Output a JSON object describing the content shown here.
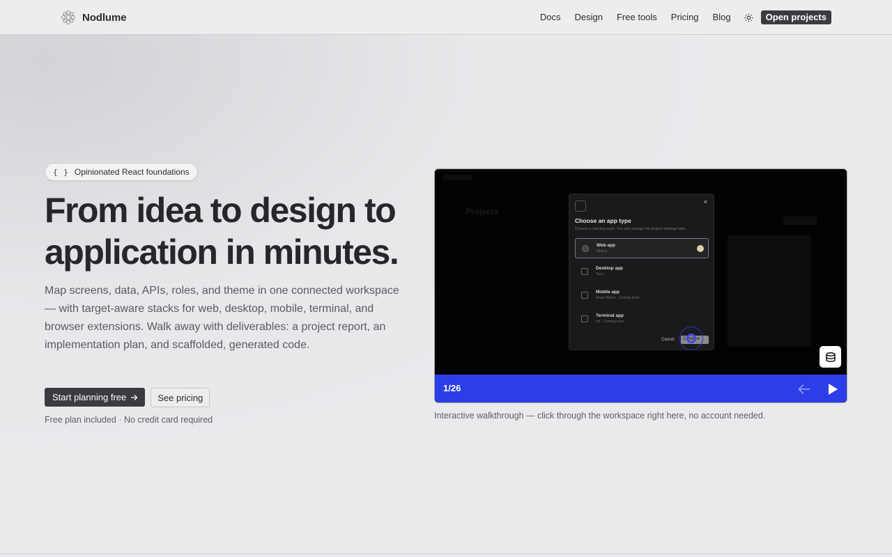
{
  "brand": {
    "name": "Nodlume"
  },
  "nav": {
    "items": [
      "Docs",
      "Design",
      "Free tools",
      "Pricing",
      "Blog"
    ],
    "cta": "Open projects"
  },
  "hero": {
    "badge": "Opinionated React foundations",
    "badge_icon": "{ }",
    "title": "From idea to design to application in minutes.",
    "subtitle": "Map screens, data, APIs, roles, and theme in one connected workspace — with target-aware stacks for web, desktop, mobile, terminal, and browser extensions. Walk away with deliverables: a project report, an implementation plan, and scaffolded, generated code.",
    "primary_cta": "Start planning free",
    "secondary_cta": "See pricing",
    "fineprint": "Free plan included · No credit card required"
  },
  "walkthrough": {
    "counter": "1/26",
    "caption": "Interactive walkthrough — click through the workspace right here, no account needed.",
    "accent_color": "#2c3ee8",
    "screen": {
      "background_title": "Projects",
      "modal": {
        "title": "Choose an app type",
        "description": "Choose a starting point. You can change the project settings later.",
        "close": "×",
        "options": [
          {
            "name": "Web app",
            "sub": "Next.js",
            "selected": true
          },
          {
            "name": "Desktop app",
            "sub": "Tauri",
            "selected": false
          },
          {
            "name": "Mobile app",
            "sub": "React Native · Coming soon",
            "selected": false
          },
          {
            "name": "Terminal app",
            "sub": "Ink · Coming soon",
            "selected": false
          }
        ],
        "cancel": "Cancel",
        "continue": "Continue"
      }
    }
  }
}
